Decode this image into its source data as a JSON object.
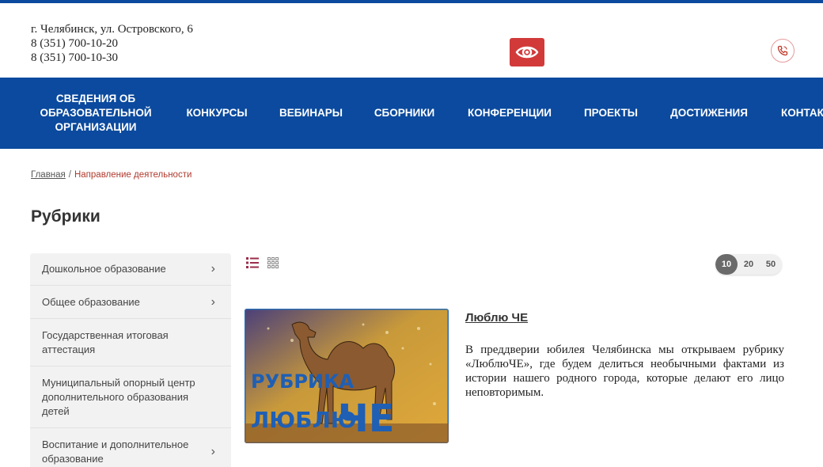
{
  "header": {
    "address": "г. Челябинск, ул. Островского, 6",
    "phone1": "8 (351) 700-10-20",
    "phone2": "8 (351) 700-10-30",
    "accessibility_icon": "eye-icon",
    "call_icon": "phone-icon"
  },
  "nav": {
    "items": [
      {
        "label": "СВЕДЕНИЯ ОБ\nОБРАЗОВАТЕЛЬНОЙ\nОРГАНИЗАЦИИ"
      },
      {
        "label": "КОНКУРСЫ"
      },
      {
        "label": "ВЕБИНАРЫ"
      },
      {
        "label": "СБОРНИКИ"
      },
      {
        "label": "КОНФЕРЕНЦИИ"
      },
      {
        "label": "ПРОЕКТЫ"
      },
      {
        "label": "ДОСТИЖЕНИЯ"
      },
      {
        "label": "КОНТАКТЫ"
      }
    ]
  },
  "breadcrumb": {
    "home": "Главная",
    "separator": "/",
    "current": "Направление деятельности"
  },
  "page": {
    "title": "Рубрики"
  },
  "sidebar": {
    "items": [
      {
        "label": "Дошкольное образование",
        "has_arrow": true
      },
      {
        "label": "Общее образование",
        "has_arrow": true
      },
      {
        "label": "Государственная итоговая аттестация",
        "has_arrow": false
      },
      {
        "label": "Муниципальный опорный центр дополнительного образования детей",
        "has_arrow": false
      },
      {
        "label": "Воспитание и дополнительное образование",
        "has_arrow": true
      }
    ]
  },
  "toolbar": {
    "list_view_icon": "list-view-icon",
    "grid_view_icon": "grid-view-icon",
    "page_sizes": [
      "10",
      "20",
      "50"
    ],
    "active_page_size": "10"
  },
  "article": {
    "title": "Люблю ЧЕ",
    "image_text_line1": "РУБРИКА",
    "image_text_line2": "ЛЮБЛЮ",
    "image_text_line3": "ЧЕ",
    "text": "В преддверии юбилея Челябинска мы открываем рубрику «ЛюблюЧЕ», где будем делиться необычными фактами из истории нашего родного города, которые делают его лицо неповторимым."
  },
  "colors": {
    "brand_blue": "#0b4a9e",
    "accent_red": "#d23a3a",
    "breadcrumb_current": "#b03a2e"
  }
}
